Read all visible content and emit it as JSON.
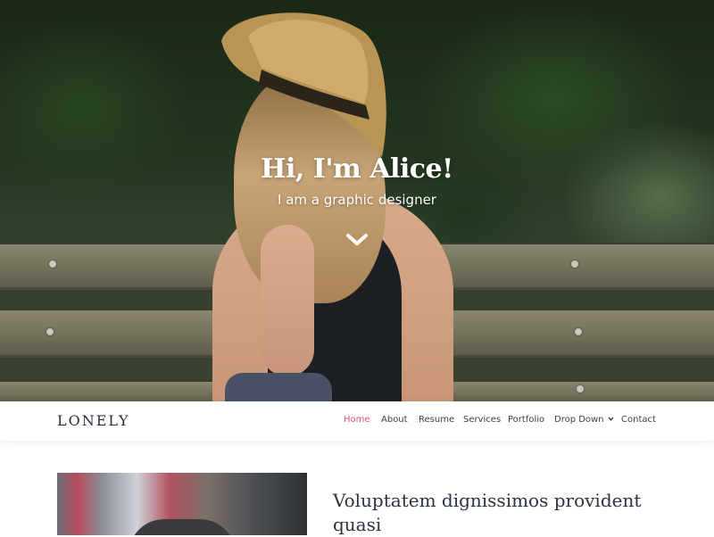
{
  "hero": {
    "title": "Hi, I'm Alice!",
    "subtitle": "I am a graphic designer",
    "scroll_icon": "chevron-down-icon"
  },
  "nav": {
    "logo": "LONELY",
    "items": [
      {
        "label": "Home",
        "active": true
      },
      {
        "label": "About"
      },
      {
        "label": "Resume"
      },
      {
        "label": "Services"
      },
      {
        "label": "Portfolio"
      },
      {
        "label": "Drop Down",
        "has_dropdown": true
      },
      {
        "label": "Contact"
      }
    ],
    "active_color": "#e0506d"
  },
  "content": {
    "article_title": "Voluptatem dignissimos provident quasi"
  }
}
